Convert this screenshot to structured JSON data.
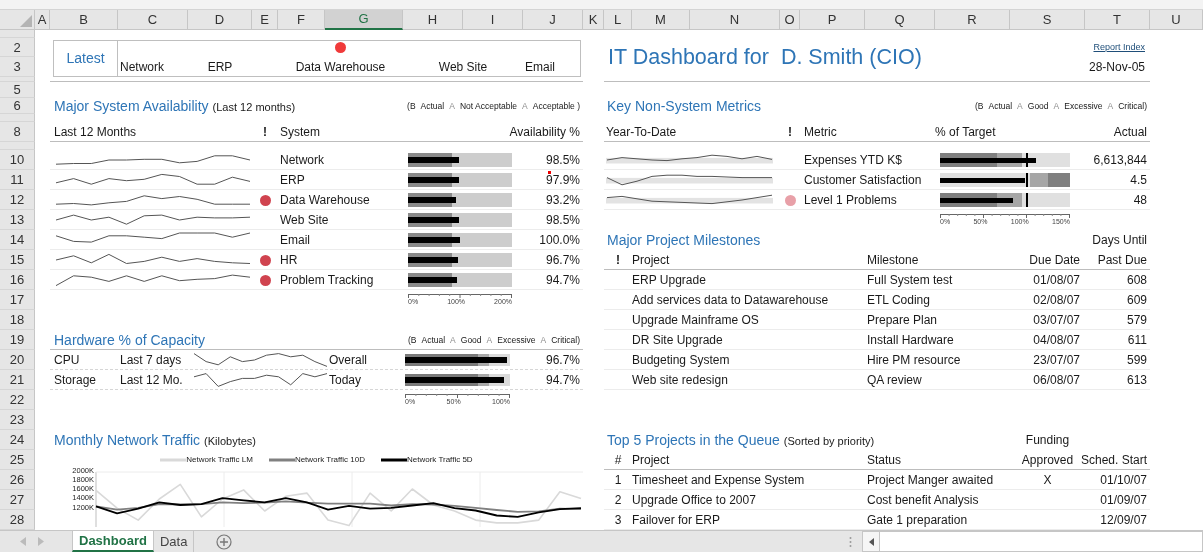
{
  "column_headers": [
    {
      "label": "A",
      "selected": false
    },
    {
      "label": "B",
      "selected": false
    },
    {
      "label": "C",
      "selected": false
    },
    {
      "label": "D",
      "selected": false
    },
    {
      "label": "E",
      "selected": false
    },
    {
      "label": "F",
      "selected": false
    },
    {
      "label": "G",
      "selected": true
    },
    {
      "label": "H",
      "selected": false
    },
    {
      "label": "I",
      "selected": false
    },
    {
      "label": "J",
      "selected": false
    },
    {
      "label": "K",
      "selected": false
    },
    {
      "label": "L",
      "selected": false
    },
    {
      "label": "M",
      "selected": false
    },
    {
      "label": "N",
      "selected": false
    },
    {
      "label": "O",
      "selected": false
    },
    {
      "label": "P",
      "selected": false
    },
    {
      "label": "Q",
      "selected": false
    },
    {
      "label": "R",
      "selected": false
    },
    {
      "label": "S",
      "selected": false
    },
    {
      "label": "T",
      "selected": false
    },
    {
      "label": "U",
      "selected": false
    }
  ],
  "row_headers": [
    "2",
    "3",
    "5",
    "6",
    "8",
    "10",
    "11",
    "12",
    "13",
    "14",
    "15",
    "16",
    "17",
    "18",
    "19",
    "20",
    "21",
    "22",
    "23",
    "24",
    "25",
    "26",
    "27",
    "28"
  ],
  "status_panel": {
    "title": "Latest",
    "systems": [
      {
        "name": "Network",
        "alert": false
      },
      {
        "name": "ERP",
        "alert": false
      },
      {
        "name": "Data Warehouse",
        "alert": true
      },
      {
        "name": "Web Site",
        "alert": false
      },
      {
        "name": "Email",
        "alert": false
      }
    ]
  },
  "header": {
    "title": "IT Dashboard for  D. Smith (CIO)",
    "link": "Report Index",
    "date": "28-Nov-05"
  },
  "availability": {
    "title": "Major System Availability",
    "subtitle": "(Last 12 months)",
    "legend": [
      {
        "text": "(B",
        "muted": false
      },
      {
        "text": "Actual",
        "muted": false
      },
      {
        "text": "A",
        "muted": true
      },
      {
        "text": "Not Acceptable",
        "muted": false
      },
      {
        "text": "A",
        "muted": true
      },
      {
        "text": "Acceptable )",
        "muted": false
      }
    ],
    "columns": [
      "Last 12 Months",
      "!",
      "System",
      "Availability %"
    ],
    "rows": [
      {
        "name": "Network",
        "alert": false,
        "has_comment": false,
        "level": 0.4925,
        "reading": "98.5%"
      },
      {
        "name": "ERP",
        "alert": false,
        "has_comment": true,
        "level": 0.4895,
        "reading": "97.9%"
      },
      {
        "name": "Data Warehouse",
        "alert": true,
        "has_comment": false,
        "level": 0.466,
        "reading": "93.2%"
      },
      {
        "name": "Web Site",
        "alert": false,
        "has_comment": false,
        "level": 0.4925,
        "reading": "98.5%"
      },
      {
        "name": "Email",
        "alert": false,
        "has_comment": false,
        "level": 0.5,
        "reading": "100.0%"
      },
      {
        "name": "HR",
        "alert": true,
        "has_comment": false,
        "level": 0.4835,
        "reading": "96.7%"
      },
      {
        "name": "Problem Tracking",
        "alert": true,
        "has_comment": false,
        "level": 0.4735,
        "reading": "94.7%"
      }
    ],
    "axis": [
      "0%",
      "100%",
      "200%"
    ]
  },
  "hardware": {
    "title": "Hardware % of Capacity",
    "legend": [
      {
        "text": "(B",
        "muted": false
      },
      {
        "text": "Actual",
        "muted": false
      },
      {
        "text": "A",
        "muted": true
      },
      {
        "text": "Good",
        "muted": false
      },
      {
        "text": "A",
        "muted": true
      },
      {
        "text": "Excessive",
        "muted": false
      },
      {
        "text": "A",
        "muted": true
      },
      {
        "text": "Critical)",
        "muted": false
      }
    ],
    "rows": [
      {
        "resource": "CPU",
        "period": "Last 7 days",
        "measure": "Overall",
        "level": 0.967,
        "reading": "96.7%"
      },
      {
        "resource": "Storage",
        "period": "Last 12 Mo.",
        "measure": "Today",
        "level": 0.947,
        "reading": "94.7%"
      }
    ],
    "axis": [
      "0%",
      "50%",
      "100%"
    ]
  },
  "traffic": {
    "title": "Monthly Network Traffic",
    "subtitle": "(Kilobytes)",
    "chart_data": {
      "type": "line",
      "categories": [
        null,
        null,
        null,
        null,
        null,
        null,
        null,
        null,
        null,
        null,
        null,
        null,
        null,
        null,
        null,
        null,
        null,
        null,
        null,
        null,
        null,
        null,
        null,
        null
      ],
      "ylim": [
        800,
        2000
      ],
      "grid": true,
      "yticks": [
        {
          "value": 2000,
          "label": "2000K"
        },
        {
          "value": 1800,
          "label": "1800K"
        },
        {
          "value": 1600,
          "label": "1600K"
        },
        {
          "value": 1400,
          "label": "1400K"
        },
        {
          "value": 1200,
          "label": "1200K"
        }
      ],
      "series": [
        {
          "name": "Network Traffic LM",
          "color": "#d9d9d9",
          "values": [
            1600,
            1210,
            950,
            1410,
            1730,
            1020,
            1410,
            1610,
            1150,
            1470,
            1540,
            950,
            830,
            1540,
            1150,
            1630,
            1280,
            1150,
            950,
            890,
            890,
            950,
            1570,
            1420
          ]
        },
        {
          "name": "Network Traffic 10D",
          "color": "#808080",
          "values": [
            1250,
            1180,
            1220,
            1300,
            1290,
            1300,
            1340,
            1320,
            1330,
            1360,
            1330,
            1310,
            1310,
            1310,
            1270,
            1300,
            1290,
            1260,
            1220,
            1170,
            1130,
            1140,
            1200,
            1190
          ]
        },
        {
          "name": "Network Traffic 5D",
          "color": "#000000",
          "values": [
            1250,
            1100,
            1200,
            1340,
            1280,
            1300,
            1430,
            1380,
            1340,
            1430,
            1340,
            1180,
            1260,
            1200,
            1220,
            1270,
            1320,
            1210,
            1160,
            1050,
            1020,
            1120,
            1190,
            1210
          ]
        }
      ]
    }
  },
  "metrics": {
    "title": "Key Non-System Metrics",
    "legend": [
      {
        "text": "(B",
        "muted": false
      },
      {
        "text": "Actual",
        "muted": false
      },
      {
        "text": "A",
        "muted": true
      },
      {
        "text": "Good",
        "muted": false
      },
      {
        "text": "A",
        "muted": true
      },
      {
        "text": "Excessive",
        "muted": false
      },
      {
        "text": "A",
        "muted": true
      },
      {
        "text": "Critical)",
        "muted": false
      }
    ],
    "columns": [
      "Year-To-Date",
      "!",
      "Metric",
      "% of Target",
      "Actual"
    ],
    "rows": [
      {
        "name": "Expenses YTD K$",
        "alert": false,
        "kind": "lower_is_better",
        "level": 0.74,
        "reading": "6,613,844"
      },
      {
        "name": "Customer Satisfaction",
        "alert": false,
        "kind": "higher_is_better",
        "level": 0.65,
        "reading": "4.5"
      },
      {
        "name": "Level 1 Problems",
        "alert": true,
        "kind": "lower_is_better",
        "level": 0.56,
        "reading": "48"
      }
    ],
    "axis": [
      "0%",
      "50%",
      "100%",
      "150%"
    ]
  },
  "milestones": {
    "title": "Major Project Milestones",
    "column_note": "Days Until",
    "columns": [
      "!",
      "Project",
      "Milestone",
      "Due Date",
      "Past Due"
    ],
    "rows": [
      {
        "project": "ERP Upgrade",
        "milestone": "Full System test",
        "due": "01/08/07",
        "days": "608"
      },
      {
        "project": "Add services data to Datawarehouse",
        "milestone": "ETL Coding",
        "due": "02/08/07",
        "days": "609"
      },
      {
        "project": "Upgrade Mainframe OS",
        "milestone": "Prepare Plan",
        "due": "03/07/07",
        "days": "579"
      },
      {
        "project": "DR Site Upgrade",
        "milestone": "Install Hardware",
        "due": "04/08/07",
        "days": "611"
      },
      {
        "project": "Budgeting System",
        "milestone": "Hire PM resource",
        "due": "23/07/07",
        "days": "599"
      },
      {
        "project": "Web site redesign",
        "milestone": "QA review",
        "due": "06/08/07",
        "days": "613"
      }
    ]
  },
  "queue": {
    "title": "Top 5 Projects in the Queue",
    "subtitle": "(Sorted by priority)",
    "column_note": "Funding",
    "columns": [
      "#",
      "Project",
      "Status",
      "Approved",
      "Sched. Start"
    ],
    "rows": [
      {
        "rank": "1",
        "project": "Timesheet and Expense System",
        "status": "Project Manger awaited",
        "approved": "X",
        "start": "01/10/07"
      },
      {
        "rank": "2",
        "project": "Upgrade Office to 2007",
        "status": "Cost benefit Analysis",
        "start": "01/09/07"
      },
      {
        "rank": "3",
        "project": "Failover for ERP",
        "status": "Gate 1 preparation",
        "start": "12/09/07"
      }
    ]
  },
  "sheet_tabs": [
    {
      "label": "Dashboard",
      "selected": true
    },
    {
      "label": "Data",
      "selected": false
    }
  ]
}
